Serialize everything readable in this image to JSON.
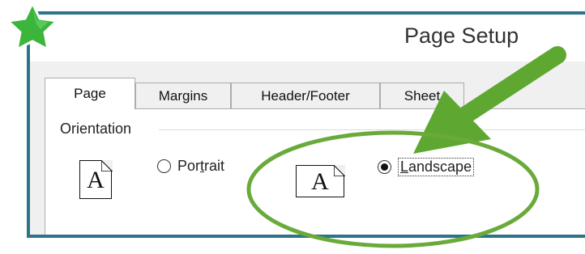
{
  "window": {
    "title": "Page Setup"
  },
  "tabs": [
    {
      "label": "Page",
      "active": true
    },
    {
      "label": "Margins",
      "active": false
    },
    {
      "label": "Header/Footer",
      "active": false
    },
    {
      "label": "Sheet",
      "active": false
    }
  ],
  "orientation": {
    "group_label": "Orientation",
    "icon_letter": "A",
    "portrait": {
      "label_before": "Por",
      "label_underlined": "t",
      "label_after": "rait",
      "selected": false
    },
    "landscape": {
      "label_before": "",
      "label_underlined": "L",
      "label_after": "andscape",
      "selected": true
    }
  },
  "annotation": {
    "star_color": "#3cb53c",
    "arrow_color": "#5ea832",
    "circle_color": "#6aaa3a",
    "frame_color": "#2c7489"
  }
}
